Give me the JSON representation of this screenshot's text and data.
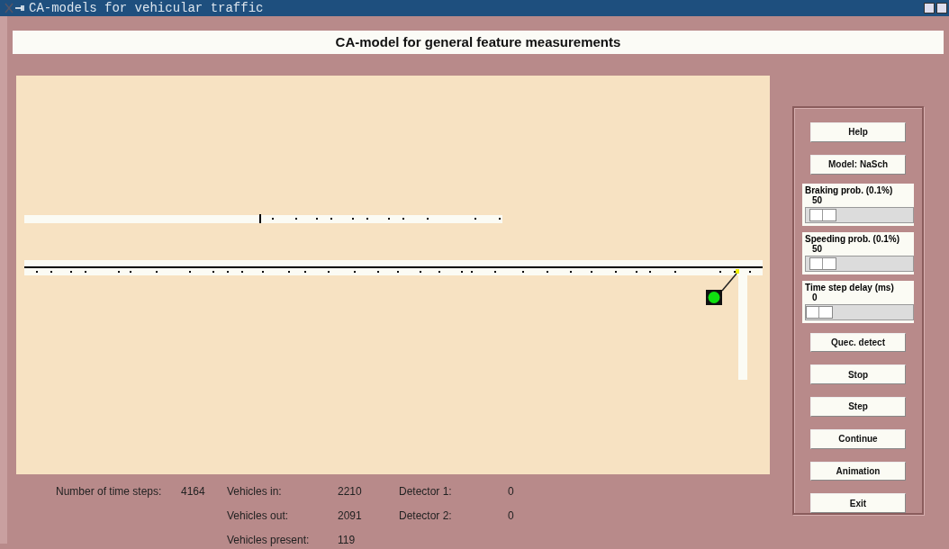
{
  "window": {
    "title": "CA-models for vehicular traffic"
  },
  "header": "CA-model for general feature measurements",
  "panel": {
    "items": [
      {
        "kind": "button",
        "label": "Help"
      },
      {
        "kind": "button",
        "label": "Model: NaSch"
      },
      {
        "kind": "slider",
        "label": "Braking prob. (0.1%)",
        "reading": "50",
        "level": 0.05
      },
      {
        "kind": "slider",
        "label": "Speeding prob. (0.1%)",
        "reading": "50",
        "level": 0.05
      },
      {
        "kind": "slider",
        "label": "Time step delay (ms)",
        "reading": "0",
        "level": 0
      },
      {
        "kind": "button",
        "label": "Quec. detect"
      },
      {
        "kind": "button",
        "label": "Stop"
      },
      {
        "kind": "button",
        "label": "Step"
      },
      {
        "kind": "button",
        "label": "Continue"
      },
      {
        "kind": "button",
        "label": "Animation"
      },
      {
        "kind": "button",
        "label": "Exit"
      }
    ]
  },
  "stat_groups": [
    [
      {
        "label": "Number of time steps:",
        "value": "4164"
      }
    ],
    [
      {
        "label": "Vehicles in:",
        "value": "2210"
      },
      {
        "label": "Vehicles out:",
        "value": "2091"
      },
      {
        "label": "Vehicles present:",
        "value": "119"
      }
    ],
    [
      {
        "label": "Detector 1:",
        "value": "0"
      },
      {
        "label": "Detector 2:",
        "value": "0"
      }
    ]
  ]
}
